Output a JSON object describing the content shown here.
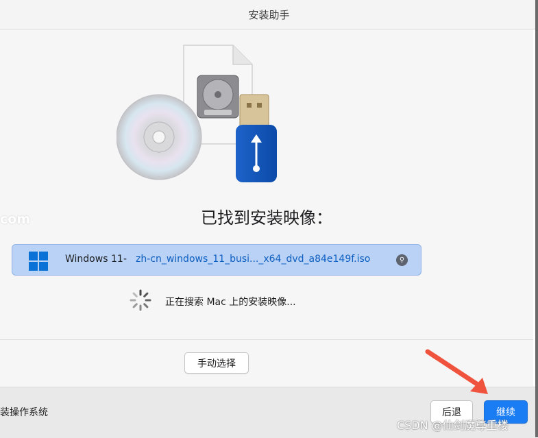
{
  "window": {
    "title": "安装助手"
  },
  "watermark_left": "com",
  "found": {
    "title": "已找到安装映像："
  },
  "image_row": {
    "os_label": "Windows 11",
    "separator": "-",
    "file_name": "zh-cn_windows_11_busi..._x64_dvd_a84e149f.iso",
    "reveal_icon": "magnifier-icon"
  },
  "status": {
    "searching_text": "正在搜索 Mac 上的安装映像..."
  },
  "buttons": {
    "manual": "手动选择",
    "back": "后退",
    "continue": "继续"
  },
  "footer": {
    "left_text": "装操作系统"
  },
  "watermark_csdn": "CSDN @仙剑魔尊重楼",
  "colors": {
    "accent": "#1a7df4",
    "selection": "#b9d2f5",
    "annotation_arrow": "#f0533d"
  }
}
